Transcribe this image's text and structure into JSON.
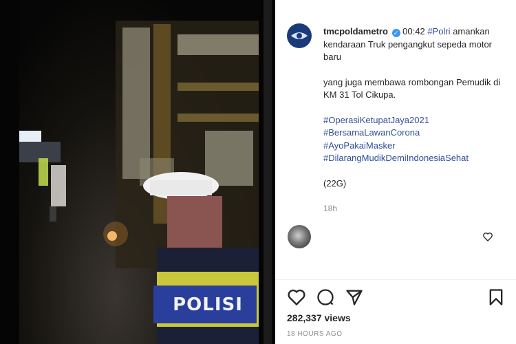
{
  "post": {
    "username": "tmcpoldametro",
    "time": "00:42",
    "tag_polri": "#Polri",
    "line1": "amankan kendaraan Truk pengangkut sepeda motor baru",
    "line2": "yang juga membawa rombongan Pemudik di KM 31 Tol Cikupa.",
    "hashtags": [
      "#OperasiKetupatJaya2021",
      "#BersamaLawanCorona",
      "#AyoPakaiMasker",
      "#DilarangMudikDemiIndonesiaSehat"
    ],
    "code": "(22G)",
    "age": "18h"
  },
  "video": {
    "badge_text": "POLISI"
  },
  "stats": {
    "views": "282,337 views",
    "posted": "18 HOURS AGO"
  },
  "colors": {
    "hashtag": "#2f4f99",
    "verified": "#3897f0",
    "muted": "#8e8e8e"
  },
  "icons": [
    "heart-icon",
    "comment-icon",
    "share-icon",
    "bookmark-icon",
    "verified-icon"
  ]
}
